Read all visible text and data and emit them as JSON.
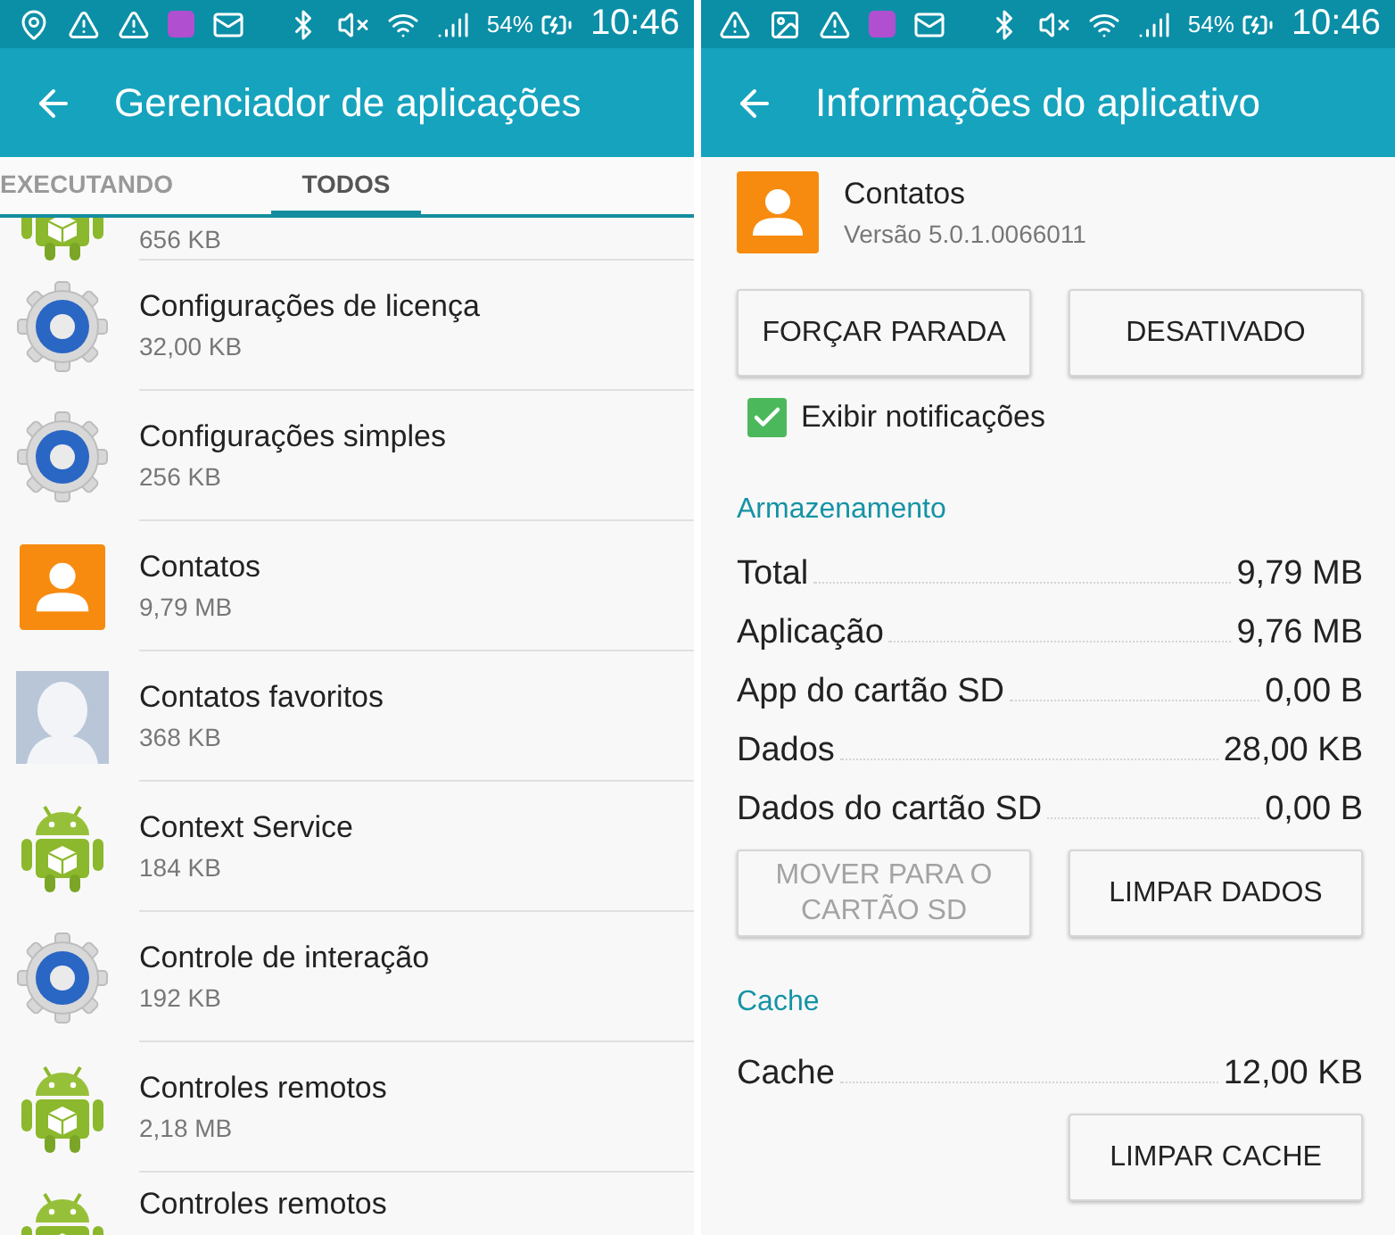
{
  "left_screen": {
    "status_bar": {
      "battery": "54%",
      "time": "10:46"
    },
    "app_bar": {
      "title": "Gerenciador de aplicações"
    },
    "tabs": [
      {
        "label": "EXECUTANDO",
        "selected": false
      },
      {
        "label": "TODOS",
        "selected": true
      }
    ],
    "apps": [
      {
        "kind": "android",
        "size": "656 KB"
      },
      {
        "kind": "gear",
        "name": "Configurações de licença",
        "size": "32,00 KB"
      },
      {
        "kind": "gear",
        "name": "Configurações simples",
        "size": "256 KB"
      },
      {
        "kind": "contacts",
        "name": "Contatos",
        "size": "9,79 MB"
      },
      {
        "kind": "avatar",
        "name": "Contatos favoritos",
        "size": "368 KB"
      },
      {
        "kind": "android",
        "name": "Context Service",
        "size": "184 KB"
      },
      {
        "kind": "gear",
        "name": "Controle de interação",
        "size": "192 KB"
      },
      {
        "kind": "android",
        "name": "Controles remotos",
        "size": "2,18 MB"
      },
      {
        "kind": "android",
        "name": "Controles remotos"
      }
    ]
  },
  "right_screen": {
    "status_bar": {
      "battery": "54%",
      "time": "10:46"
    },
    "app_bar": {
      "title": "Informações do aplicativo"
    },
    "app": {
      "name": "Contatos",
      "version": "Versão 5.0.1.0066011"
    },
    "actions": [
      {
        "label": "FORÇAR PARADA",
        "disabled": false
      },
      {
        "label": "DESATIVADO",
        "disabled": false
      }
    ],
    "notifications": {
      "label": "Exibir notificações",
      "checked": true
    },
    "sections": [
      {
        "title": "Armazenamento",
        "rows": [
          {
            "label": "Total",
            "value": "9,79 MB"
          },
          {
            "label": "Aplicação",
            "value": "9,76 MB"
          },
          {
            "label": "App do cartão SD",
            "value": "0,00 B"
          },
          {
            "label": "Dados",
            "value": "28,00 KB"
          },
          {
            "label": "Dados do cartão SD",
            "value": "0,00 B"
          }
        ],
        "buttons": [
          {
            "label": "MOVER PARA O CARTÃO SD",
            "disabled": true
          },
          {
            "label": "LIMPAR DADOS",
            "disabled": false
          }
        ]
      },
      {
        "title": "Cache",
        "rows": [
          {
            "label": "Cache",
            "value": "12,00 KB"
          }
        ],
        "buttons": [
          {
            "label": "LIMPAR CACHE",
            "disabled": false
          }
        ]
      }
    ]
  }
}
